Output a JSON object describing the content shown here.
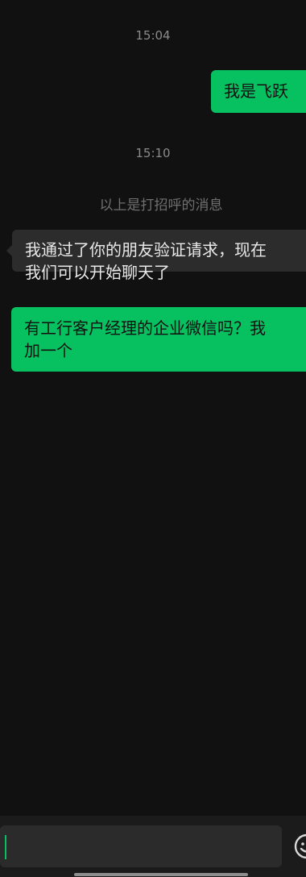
{
  "messages": {
    "time_1": "15:04",
    "out_1": "我是飞跃",
    "time_2": "15:10",
    "system_note": "以上是打招呼的消息",
    "in_1_line1": "我通过了你的朋友验证请求，现在",
    "in_1_line2": "我们可以开始聊天了",
    "out_2_line1": "有工行客户经理的企业微信吗？我",
    "out_2_line2": "加一个"
  },
  "input": {
    "value": ""
  },
  "icons": {
    "emoji": "emoji-icon"
  },
  "colors": {
    "background": "#111111",
    "accent_green": "#07c160",
    "incoming_bubble": "#2c2c2c",
    "meta_text": "#8a8a8a"
  }
}
